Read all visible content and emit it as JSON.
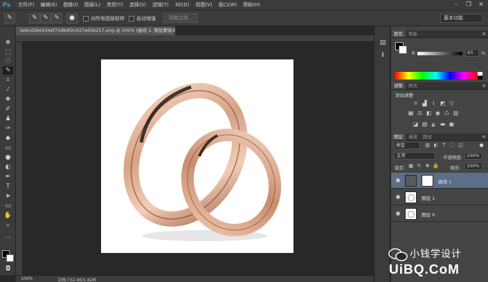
{
  "app": {
    "logo": "Ps"
  },
  "menu": [
    "文件(F)",
    "编辑(E)",
    "图像(I)",
    "图层(L)",
    "类型(Y)",
    "选择(S)",
    "滤镜(T)",
    "3D(D)",
    "视图(V)",
    "窗口(W)",
    "帮助(H)"
  ],
  "window_controls": [
    "minimize-icon",
    "restore-icon",
    "close-icon"
  ],
  "options": {
    "sample_all_layers": "对所有图层取样",
    "auto_enhance": "自动增强",
    "refine_edge": "调整边缘...",
    "workspace": "基本功能"
  },
  "document": {
    "tab_title": "3e6cd3be534ef72db9f2c027a65b217.png @ 100% (曲线 1, 图层蒙版/8) *",
    "zoom": "100%",
    "info": "文档:732.4K/1.82M"
  },
  "panels": {
    "color_tabs": [
      "颜色",
      "色板"
    ],
    "k_label": "K",
    "k_value": "93",
    "k_unit": "%",
    "k_level_percent": 93,
    "adjust_tabs": [
      "调整",
      "样式"
    ],
    "adjust_title": "添加调整",
    "layers_tabs": [
      "图层",
      "通道",
      "路径"
    ],
    "filter_kind": "类型",
    "blend_mode": "正常",
    "opacity_label": "不透明度:",
    "opacity_value": "100%",
    "lock_label": "锁定:",
    "fill_label": "填充:",
    "fill_value": "100%",
    "layers": [
      {
        "name": "曲线 1",
        "selected": true
      },
      {
        "name": "图层 1",
        "selected": false
      },
      {
        "name": "图层 0",
        "selected": false
      }
    ]
  },
  "watermark": {
    "text": "小钱学设计",
    "site": "UiBQ.CoM"
  }
}
